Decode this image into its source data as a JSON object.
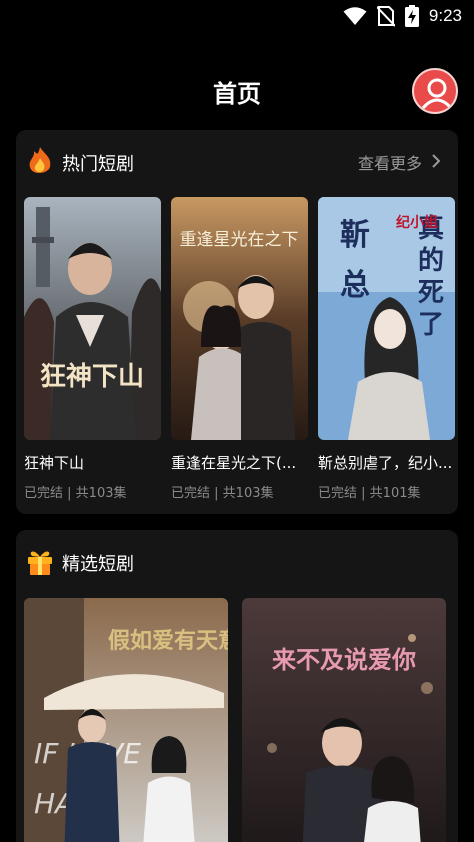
{
  "status_bar": {
    "time": "9:23",
    "icons": [
      "wifi-icon",
      "no-sim-icon",
      "battery-charging-icon"
    ]
  },
  "header": {
    "title": "首页",
    "avatar_icon": "user-avatar-icon"
  },
  "hot_section": {
    "title": "热门短剧",
    "icon": "fire-icon",
    "see_more": "查看更多",
    "items": [
      {
        "title": "狂神下山",
        "status": "已完结",
        "episodes": "共103集",
        "poster_text": "狂神下山"
      },
      {
        "title": "重逢在星光之下(...",
        "status": "已完结",
        "episodes": "共103集",
        "poster_text": "重逢星光在之下"
      },
      {
        "title": "靳总别虐了，纪小...",
        "status": "已完结",
        "episodes": "共101集",
        "poster_text": "靳总别虐了纪小姐真的死了"
      }
    ]
  },
  "picks_section": {
    "title": "精选短剧",
    "icon": "gift-icon",
    "items": [
      {
        "poster_text": "假如爱有天意"
      },
      {
        "poster_text": "来不及说爱你"
      }
    ]
  },
  "colors": {
    "background": "#000000",
    "card": "#151515",
    "avatar": "#e94a4a",
    "muted_text": "#8a8a8a"
  }
}
